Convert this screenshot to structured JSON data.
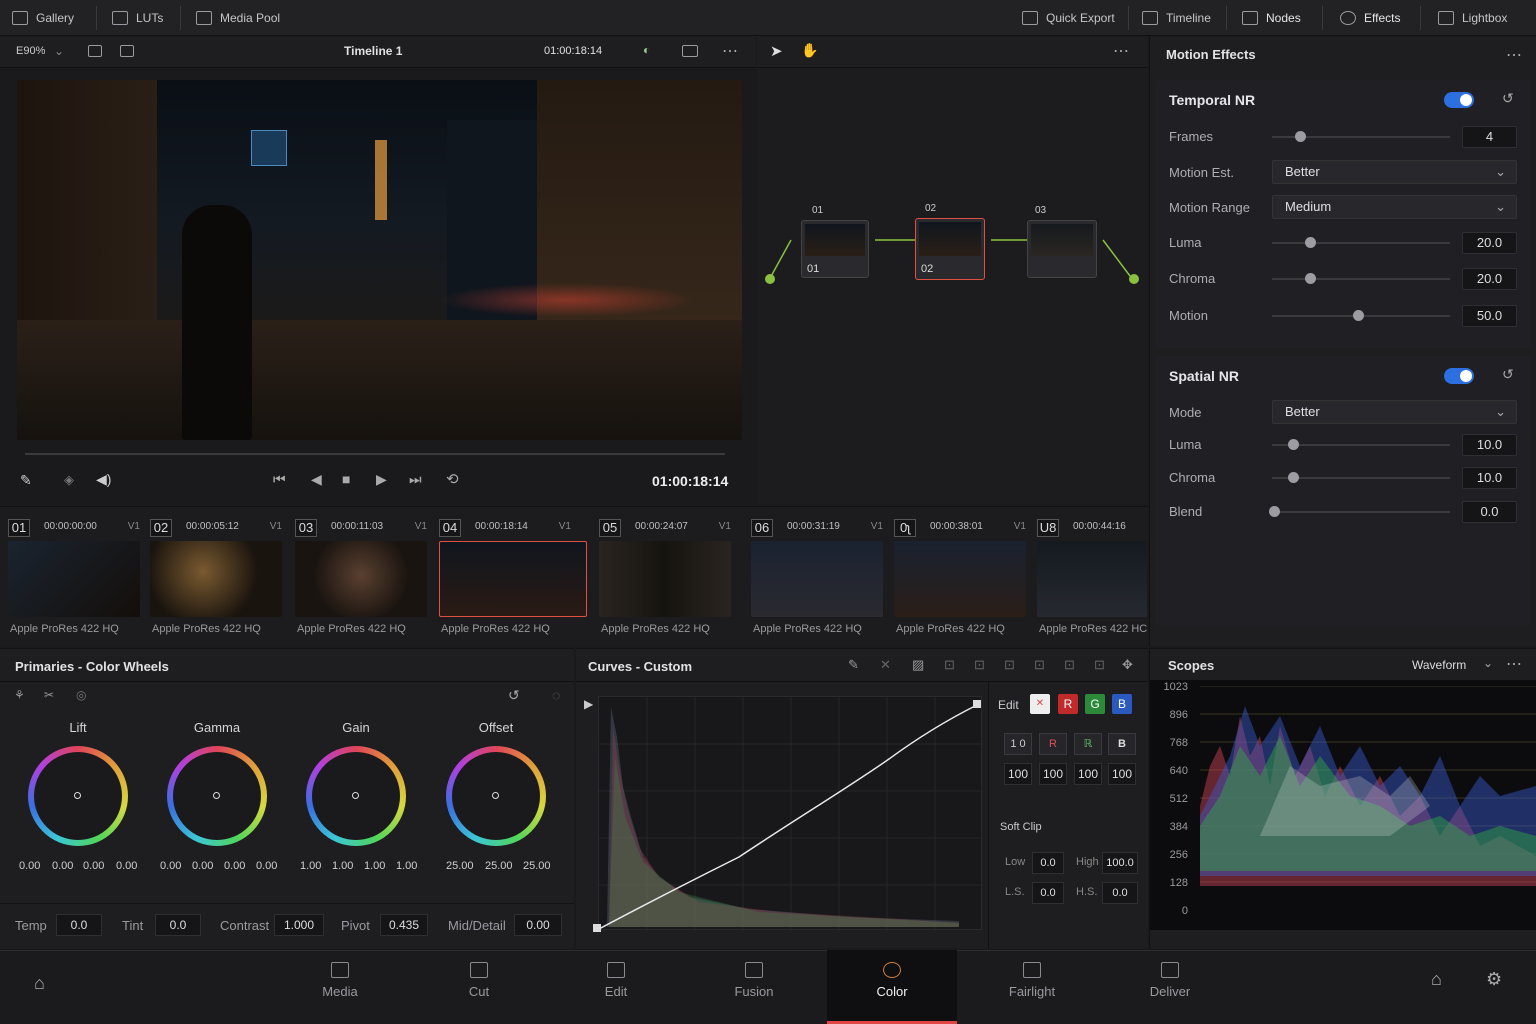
{
  "topbar": {
    "left": [
      {
        "label": "Gallery",
        "icon": "gallery-icon"
      },
      {
        "label": "LUTs",
        "icon": "luts-icon"
      },
      {
        "label": "Media Pool",
        "icon": "media-pool-icon"
      }
    ],
    "right": [
      {
        "label": "Quick Export",
        "icon": "export-icon"
      },
      {
        "label": "Timeline",
        "icon": "timeline-icon"
      },
      {
        "label": "Nodes",
        "icon": "nodes-icon"
      },
      {
        "label": "Effects",
        "icon": "effects-icon"
      },
      {
        "label": "Lightbox",
        "icon": "lightbox-icon"
      }
    ]
  },
  "viewer": {
    "zoom": "E90%",
    "timeline": "Timeline 1",
    "timecode": "01:00:18:14",
    "playhead_tc": "01:00:18:14"
  },
  "nodes": [
    {
      "num": "01",
      "label": "01"
    },
    {
      "num": "02",
      "label": "02"
    },
    {
      "num": "03",
      "label": ""
    }
  ],
  "motion_effects": {
    "title": "Motion Effects",
    "temporal": {
      "title": "Temporal NR",
      "frames_label": "Frames",
      "frames": "4",
      "motion_est_label": "Motion Est.",
      "motion_est": "Better",
      "motion_range_label": "Motion Range",
      "motion_range": "Medium",
      "luma_label": "Luma",
      "luma": "20.0",
      "chroma_label": "Chroma",
      "chroma": "20.0",
      "motion_label": "Motion",
      "motion": "50.0"
    },
    "spatial": {
      "title": "Spatial NR",
      "mode_label": "Mode",
      "mode": "Better",
      "luma_label": "Luma",
      "luma": "10.0",
      "chroma_label": "Chroma",
      "chroma": "10.0",
      "blend_label": "Blend",
      "blend": "0.0"
    }
  },
  "clips": [
    {
      "num": "01",
      "tc": "00:00:00:00",
      "track": "V1",
      "codec": "Apple ProRes 422 HQ",
      "color": "#1a1410"
    },
    {
      "num": "02",
      "tc": "00:00:05:12",
      "track": "V1",
      "codec": "Apple ProRes 422 HQ",
      "color": "#2a1e14"
    },
    {
      "num": "03",
      "tc": "00:00:11:03",
      "track": "V1",
      "codec": "Apple ProRes 422 HQ",
      "color": "#241a14"
    },
    {
      "num": "04",
      "tc": "00:00:18:14",
      "track": "V1",
      "codec": "Apple ProRes 422 HQ",
      "color": "#1a1614"
    },
    {
      "num": "05",
      "tc": "00:00:24:07",
      "track": "V1",
      "codec": "Apple ProRes 422 HQ",
      "color": "#1e1c1a"
    },
    {
      "num": "06",
      "tc": "00:00:31:19",
      "track": "V1",
      "codec": "Apple ProRes 422 HQ",
      "color": "#141a22"
    },
    {
      "num": "0ʅ",
      "tc": "00:00:38:01",
      "track": "V1",
      "codec": "Apple ProRes 422 HQ",
      "color": "#1a1c22"
    },
    {
      "num": "U8",
      "tc": "00:00:44:16",
      "track": "V1",
      "codec": "Apple ProRes 422 HC",
      "color": "#14181c"
    }
  ],
  "wheels": {
    "title": "Primaries - Color Wheels",
    "items": [
      {
        "name": "Lift",
        "vals": [
          "0.00",
          "0.00",
          "0.00",
          "0.00"
        ]
      },
      {
        "name": "Gamma",
        "vals": [
          "0.00",
          "0.00",
          "0.00",
          "0.00"
        ]
      },
      {
        "name": "Gain",
        "vals": [
          "1.00",
          "1.00",
          "1.00",
          "1.00"
        ]
      },
      {
        "name": "Offset",
        "vals": [
          "25.00",
          "25.00",
          "25.00"
        ]
      }
    ],
    "bottom": {
      "temp_label": "Temp",
      "temp": "0.0",
      "tint_label": "Tint",
      "tint": "0.0",
      "contrast_label": "Contrast",
      "contrast": "1.000",
      "pivot_label": "Pivot",
      "pivot": "0.435",
      "mid_label": "Mid/Detail",
      "mid": "0.00"
    }
  },
  "curves": {
    "title": "Curves - Custom",
    "edit_label": "Edit",
    "channels": [
      "R",
      "G",
      "B"
    ],
    "chan_row2": [
      "1 0",
      "R",
      "ℝ",
      "B"
    ],
    "intensity": [
      "100",
      "100",
      "100",
      "100"
    ],
    "softclip": {
      "title": "Soft Clip",
      "low_label": "Low",
      "low": "0.0",
      "high_label": "High",
      "high": "100.0",
      "ls_label": "L.S.",
      "ls": "0.0",
      "hs_label": "H.S.",
      "hs": "0.0"
    }
  },
  "scopes": {
    "title": "Scopes",
    "mode": "Waveform",
    "ticks": [
      "1023",
      "896",
      "768",
      "640",
      "512",
      "384",
      "256",
      "128",
      "0"
    ]
  },
  "pages": [
    {
      "label": "Media"
    },
    {
      "label": "Cut"
    },
    {
      "label": "Edit"
    },
    {
      "label": "Fusion"
    },
    {
      "label": "Color"
    },
    {
      "label": "Fairlight"
    },
    {
      "label": "Deliver"
    }
  ],
  "colors": {
    "accent": "#e04545",
    "toggle": "#2b6fe0",
    "active_node": "#e05040"
  }
}
